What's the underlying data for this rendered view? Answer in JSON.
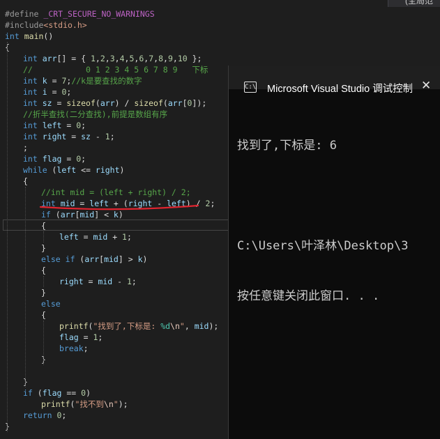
{
  "top_tab": {
    "label": "(全局范"
  },
  "editor": {
    "lines": [
      "#define _CRT_SECURE_NO_WARNINGS",
      "#include<stdio.h>",
      "int main()",
      "{",
      "int arr[] = { 1,2,3,4,5,6,7,8,9,10 };",
      "//           0 1 2 3 4 5 6 7 8 9   下标",
      "int k = 7;//k是要查找的数字",
      "int i = 0;",
      "int sz = sizeof(arr) / sizeof(arr[0]);",
      "//折半查找(二分查找),前提是数组有序",
      "int left = 0;",
      "int right = sz - 1;",
      ";",
      "int flag = 0;",
      "while (left <= right)",
      "{",
      "//int mid = (left + right) / 2;",
      "int mid = left + (right - left) / 2;",
      "if (arr[mid] < k)",
      "{",
      "left = mid + 1;",
      "}",
      "else if (arr[mid] > k)",
      "{",
      "right = mid - 1;",
      "}",
      "else",
      "{",
      "printf(\"找到了,下标是: %d\\n\", mid);",
      "flag = 1;",
      "break;",
      "}",
      "",
      "}",
      "if (flag == 0)",
      "printf(\"找不到\\n\");",
      "return 0;",
      "}"
    ]
  },
  "console": {
    "title": "Microsoft Visual Studio 调试控制台",
    "icon": "console-icon",
    "close": "✕",
    "output": [
      "找到了,下标是: 6",
      "",
      "C:\\Users\\叶泽林\\Desktop\\3",
      "按任意键关闭此窗口. . ."
    ]
  },
  "colors": {
    "background": "#1e1e1e",
    "keyword": "#569cd6",
    "comment": "#57a64a",
    "string": "#d69d85",
    "identifier": "#9cdcfe",
    "function": "#dcdcaa",
    "number": "#b5cea8",
    "annotation_underline": "#e0242f"
  }
}
